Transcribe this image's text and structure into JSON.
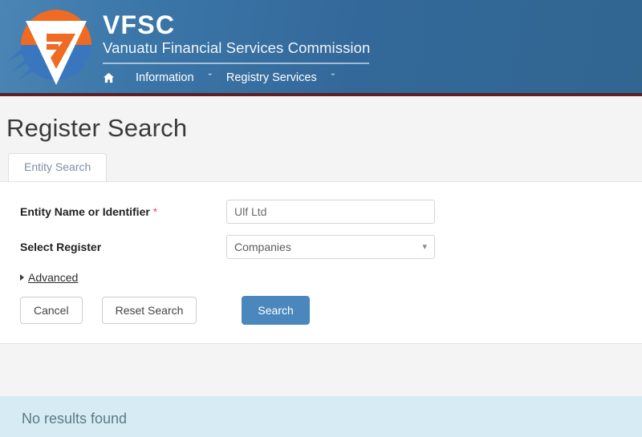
{
  "header": {
    "logo_icon": "vfsc-logo-icon",
    "brand_title": "VFSC",
    "brand_subtitle": "Vanuatu Financial Services Commission",
    "nav": {
      "home_icon": "home-icon",
      "items": [
        {
          "label": "Information",
          "caret": "ˇ"
        },
        {
          "label": "Registry Services",
          "caret": "ˇ"
        }
      ]
    }
  },
  "page": {
    "title": "Register Search"
  },
  "tabs": [
    {
      "label": "Entity Search",
      "active": true
    }
  ],
  "form": {
    "fields": [
      {
        "label": "Entity Name or Identifier",
        "required_marker": "*",
        "value": "Ulf Ltd",
        "placeholder": "Entity Name or Identifier"
      },
      {
        "label": "Select Register",
        "required_marker": "",
        "value": "Companies",
        "caret_icon": "chevron-down-icon",
        "options": [
          "Companies"
        ]
      }
    ],
    "advanced": {
      "label": "Advanced",
      "marker_icon": "triangle-right-icon"
    },
    "buttons": {
      "cancel": "Cancel",
      "reset": "Reset Search",
      "search": "Search"
    }
  },
  "results": {
    "message": "No results found"
  },
  "colors": {
    "header_blue": "#33699a",
    "header_border_red": "#5c2126",
    "logo_orange": "#ef6a23",
    "logo_blue": "#3a76bd",
    "primary_button": "#4a87bd",
    "required_star": "#e4516a",
    "info_box": "#d7ebf4",
    "info_text": "#5b7a86",
    "page_background": "#f4f4f4"
  }
}
